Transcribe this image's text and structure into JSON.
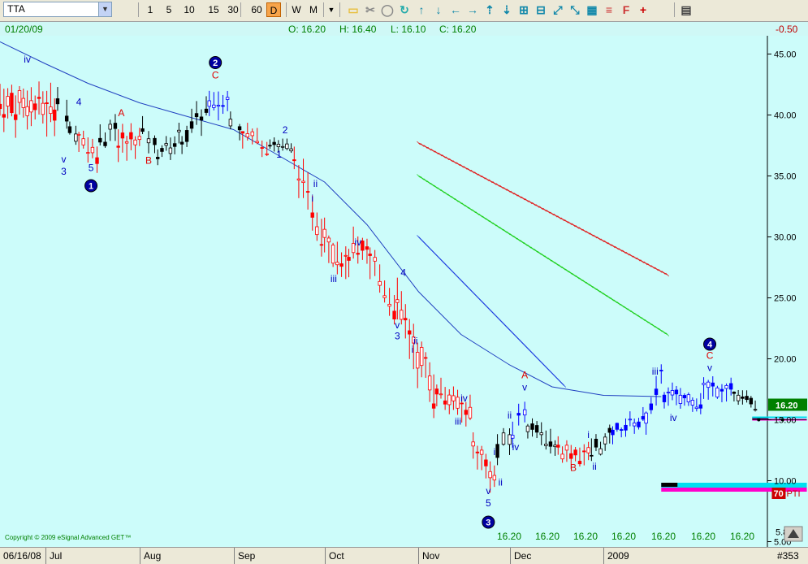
{
  "toolbar": {
    "symbol": "TTA",
    "intervals": [
      "1",
      "5",
      "10",
      "15",
      "30",
      "60",
      "D",
      "W",
      "M"
    ],
    "active_interval": "D"
  },
  "status": {
    "date": "01/20/09",
    "open": "O: 16.20",
    "high": "H: 16.40",
    "low": "L: 16.10",
    "close": "C: 16.20",
    "change": "-0.50"
  },
  "copyright": "Copyright © 2009 eSignal Advanced GET™",
  "footer_values": [
    "16.20",
    "16.20",
    "16.20",
    "16.20",
    "16.20",
    "16.20",
    "16.20"
  ],
  "bottom": {
    "start_date": "06/16/08",
    "months": [
      "Jul",
      "Aug",
      "Sep",
      "Oct",
      "Nov",
      "Dec",
      "2009"
    ],
    "chart_id": "#353"
  },
  "colors": {
    "background": "#ccfcfa",
    "up_red": "#ff0000",
    "blue_bars": "#0000ff",
    "black_bars": "#000000",
    "ma_line": "#2040c0",
    "channel_red": "#e02020",
    "channel_green": "#20d020",
    "channel_blue": "#2040e0",
    "cyan_band": "#00e0f0",
    "magenta_band": "#ff00cc"
  },
  "chart_data": {
    "type": "bar",
    "ylim": [
      4.5,
      46.5
    ],
    "y_ticks": [
      45,
      40,
      35,
      30,
      25,
      20,
      15,
      10,
      5
    ],
    "y_tick_labels": [
      "45.00",
      "40.00",
      "35.00",
      "30.00",
      "25.00",
      "20.00",
      "15.00",
      "10.00",
      "5.00"
    ],
    "current_price_label": "16.20",
    "current_price": 16.2,
    "low_marker_label": "5.80",
    "low_marker": 5.8,
    "pti_value": "70",
    "pti_label": "PTI",
    "x_months": [
      {
        "label": "Jul",
        "date": "2008-07-01"
      },
      {
        "label": "Aug",
        "date": "2008-08-01"
      },
      {
        "label": "Sep",
        "date": "2008-09-01"
      },
      {
        "label": "Oct",
        "date": "2008-10-01"
      },
      {
        "label": "Nov",
        "date": "2008-11-01"
      },
      {
        "label": "Dec",
        "date": "2008-12-01"
      },
      {
        "label": "2009",
        "date": "2009-01-01"
      }
    ],
    "start_date": "2008-06-16",
    "end_date": "2009-02-24",
    "moving_average": [
      [
        "2008-06-16",
        46.0
      ],
      [
        "2008-07-01",
        44.2
      ],
      [
        "2008-07-15",
        42.6
      ],
      [
        "2008-08-01",
        41.0
      ],
      [
        "2008-08-15",
        40.0
      ],
      [
        "2008-09-01",
        38.8
      ],
      [
        "2008-09-15",
        36.8
      ],
      [
        "2008-10-01",
        34.5
      ],
      [
        "2008-10-15",
        31.0
      ],
      [
        "2008-11-01",
        25.5
      ],
      [
        "2008-11-15",
        22.0
      ],
      [
        "2008-12-01",
        19.5
      ],
      [
        "2008-12-15",
        17.7
      ],
      [
        "2009-01-01",
        17.0
      ],
      [
        "2009-01-20",
        16.9
      ]
    ],
    "channels": [
      {
        "color_key": "channel_red",
        "start": [
          "2008-11-01",
          37.7
        ],
        "end": [
          "2009-01-22",
          26.9
        ]
      },
      {
        "color_key": "channel_green",
        "start": [
          "2008-11-01",
          35.0
        ],
        "end": [
          "2009-01-22",
          22.0
        ]
      },
      {
        "color_key": "channel_blue",
        "start": [
          "2008-11-01",
          30.0
        ],
        "end": [
          "2008-12-19",
          17.8
        ]
      }
    ],
    "bar_segments": [
      {
        "color": "red",
        "from": "2008-06-16",
        "to": "2008-07-04",
        "start": 41.0,
        "end": 40.5,
        "range": 3.0
      },
      {
        "color": "black",
        "from": "2008-07-05",
        "to": "2008-07-08",
        "start": 42.0,
        "end": 40.0,
        "range": 2.0
      },
      {
        "color": "black",
        "from": "2008-07-09",
        "to": "2008-07-11",
        "start": 38.5,
        "end": 38.0,
        "range": 1.5
      },
      {
        "color": "red",
        "from": "2008-07-12",
        "to": "2008-07-18",
        "start": 38.5,
        "end": 36.8,
        "range": 2.0
      },
      {
        "color": "black",
        "from": "2008-07-19",
        "to": "2008-07-24",
        "start": 38.0,
        "end": 39.3,
        "range": 1.8
      },
      {
        "color": "red",
        "from": "2008-07-25",
        "to": "2008-08-01",
        "start": 37.5,
        "end": 38.0,
        "range": 2.0
      },
      {
        "color": "black",
        "from": "2008-08-02",
        "to": "2008-08-06",
        "start": 38.5,
        "end": 37.3,
        "range": 1.8
      },
      {
        "color": "black",
        "from": "2008-08-07",
        "to": "2008-08-14",
        "start": 37.0,
        "end": 38.0,
        "range": 1.5
      },
      {
        "color": "black",
        "from": "2008-08-15",
        "to": "2008-08-23",
        "start": 38.0,
        "end": 40.5,
        "range": 2.0
      },
      {
        "color": "blue",
        "from": "2008-08-24",
        "to": "2008-08-30",
        "start": 40.5,
        "end": 41.2,
        "range": 1.8
      },
      {
        "color": "black",
        "from": "2008-08-31",
        "to": "2008-09-03",
        "start": 40.0,
        "end": 39.0,
        "range": 1.5
      },
      {
        "color": "red",
        "from": "2008-09-04",
        "to": "2008-09-12",
        "start": 38.5,
        "end": 37.5,
        "range": 1.5
      },
      {
        "color": "black",
        "from": "2008-09-13",
        "to": "2008-09-20",
        "start": 37.8,
        "end": 37.2,
        "range": 1.0
      },
      {
        "color": "red",
        "from": "2008-09-21",
        "to": "2008-09-30",
        "start": 36.0,
        "end": 30.5,
        "range": 2.5
      },
      {
        "color": "red",
        "from": "2008-10-01",
        "to": "2008-10-08",
        "start": 30.5,
        "end": 27.5,
        "range": 2.5
      },
      {
        "color": "red",
        "from": "2008-10-09",
        "to": "2008-10-15",
        "start": 28.5,
        "end": 28.5,
        "range": 2.5
      },
      {
        "color": "red",
        "from": "2008-10-16",
        "to": "2008-10-24",
        "start": 28.0,
        "end": 24.5,
        "range": 2.5
      },
      {
        "color": "red",
        "from": "2008-10-25",
        "to": "2008-11-06",
        "start": 24.0,
        "end": 17.5,
        "range": 3.0
      },
      {
        "color": "red",
        "from": "2008-11-07",
        "to": "2008-11-18",
        "start": 17.5,
        "end": 15.5,
        "range": 2.0
      },
      {
        "color": "red",
        "from": "2008-11-19",
        "to": "2008-11-26",
        "start": 13.0,
        "end": 10.3,
        "range": 2.0
      },
      {
        "color": "black",
        "from": "2008-11-27",
        "to": "2008-12-01",
        "start": 12.5,
        "end": 13.5,
        "range": 2.0
      },
      {
        "color": "blue",
        "from": "2008-12-02",
        "to": "2008-12-06",
        "start": 14.0,
        "end": 16.0,
        "range": 2.0
      },
      {
        "color": "black",
        "from": "2008-12-07",
        "to": "2008-12-16",
        "start": 14.5,
        "end": 13.0,
        "range": 1.5
      },
      {
        "color": "red",
        "from": "2008-12-17",
        "to": "2008-12-27",
        "start": 12.5,
        "end": 12.0,
        "range": 1.5
      },
      {
        "color": "black",
        "from": "2008-12-28",
        "to": "2009-01-03",
        "start": 12.5,
        "end": 13.5,
        "range": 1.5
      },
      {
        "color": "blue",
        "from": "2009-01-04",
        "to": "2009-01-14",
        "start": 14.0,
        "end": 15.0,
        "range": 1.2
      },
      {
        "color": "blue",
        "from": "2009-01-15",
        "to": "2009-01-20",
        "start": 15.5,
        "end": 18.0,
        "range": 2.0
      },
      {
        "color": "blue",
        "from": "2009-01-21",
        "to": "2009-02-02",
        "start": 17.0,
        "end": 16.5,
        "range": 1.5
      },
      {
        "color": "blue",
        "from": "2009-02-03",
        "to": "2009-02-12",
        "start": 17.5,
        "end": 17.8,
        "range": 1.5
      },
      {
        "color": "black",
        "from": "2009-02-13",
        "to": "2009-02-20",
        "start": 17.0,
        "end": 16.3,
        "range": 1.0
      }
    ],
    "wave_labels": [
      {
        "text": "iv",
        "date": "2008-06-25",
        "y": 44.3,
        "color": "blue"
      },
      {
        "text": "4",
        "date": "2008-07-12",
        "y": 40.8,
        "color": "blue"
      },
      {
        "text": "v",
        "date": "2008-07-07",
        "y": 36.1,
        "color": "blue"
      },
      {
        "text": "3",
        "date": "2008-07-07",
        "y": 35.1,
        "color": "blue"
      },
      {
        "text": "5",
        "date": "2008-07-16",
        "y": 35.4,
        "color": "blue"
      },
      {
        "text": "A",
        "date": "2008-07-26",
        "y": 39.9,
        "color": "red"
      },
      {
        "text": "B",
        "date": "2008-08-04",
        "y": 36.0,
        "color": "red"
      },
      {
        "text": "C",
        "date": "2008-08-26",
        "y": 43.0,
        "color": "red"
      },
      {
        "text": "1",
        "date": "2008-09-16",
        "y": 36.5,
        "color": "blue"
      },
      {
        "text": "2",
        "date": "2008-09-18",
        "y": 38.5,
        "color": "blue"
      },
      {
        "text": "ii",
        "date": "2008-09-28",
        "y": 34.1,
        "color": "blue"
      },
      {
        "text": "i",
        "date": "2008-09-27",
        "y": 32.9,
        "color": "blue"
      },
      {
        "text": "iv",
        "date": "2008-10-12",
        "y": 29.3,
        "color": "blue"
      },
      {
        "text": "iii",
        "date": "2008-10-04",
        "y": 26.3,
        "color": "blue"
      },
      {
        "text": "4",
        "date": "2008-10-27",
        "y": 26.8,
        "color": "blue"
      },
      {
        "text": "v",
        "date": "2008-10-25",
        "y": 22.5,
        "color": "blue"
      },
      {
        "text": "3",
        "date": "2008-10-25",
        "y": 21.6,
        "color": "blue"
      },
      {
        "text": "ii",
        "date": "2008-10-31",
        "y": 21.2,
        "color": "blue"
      },
      {
        "text": "i",
        "date": "2008-10-30",
        "y": 20.5,
        "color": "blue"
      },
      {
        "text": "iv",
        "date": "2008-11-16",
        "y": 16.5,
        "color": "blue"
      },
      {
        "text": "iii",
        "date": "2008-11-14",
        "y": 14.6,
        "color": "blue"
      },
      {
        "text": "i",
        "date": "2008-11-26",
        "y": 12.1,
        "color": "blue"
      },
      {
        "text": "v",
        "date": "2008-11-24",
        "y": 8.9,
        "color": "blue"
      },
      {
        "text": "5",
        "date": "2008-11-24",
        "y": 7.9,
        "color": "blue"
      },
      {
        "text": "ii",
        "date": "2008-11-28",
        "y": 9.6,
        "color": "blue"
      },
      {
        "text": "ii",
        "date": "2008-12-01",
        "y": 15.1,
        "color": "blue"
      },
      {
        "text": "iv",
        "date": "2008-12-03",
        "y": 12.5,
        "color": "blue"
      },
      {
        "text": "A",
        "date": "2008-12-06",
        "y": 18.4,
        "color": "red"
      },
      {
        "text": "v",
        "date": "2008-12-06",
        "y": 17.4,
        "color": "blue"
      },
      {
        "text": "B",
        "date": "2008-12-22",
        "y": 10.8,
        "color": "red"
      },
      {
        "text": "i",
        "date": "2008-12-27",
        "y": 13.5,
        "color": "blue"
      },
      {
        "text": "ii",
        "date": "2008-12-29",
        "y": 10.9,
        "color": "blue"
      },
      {
        "text": "iii",
        "date": "2009-01-18",
        "y": 18.7,
        "color": "blue"
      },
      {
        "text": "iv",
        "date": "2009-01-24",
        "y": 14.9,
        "color": "blue"
      },
      {
        "text": "C",
        "date": "2009-02-05",
        "y": 20.0,
        "color": "red"
      },
      {
        "text": "v",
        "date": "2009-02-05",
        "y": 19.0,
        "color": "blue"
      }
    ],
    "wave_circles": [
      {
        "text": "1",
        "date": "2008-07-16",
        "y": 34.2
      },
      {
        "text": "2",
        "date": "2008-08-26",
        "y": 44.3
      },
      {
        "text": "3",
        "date": "2008-11-24",
        "y": 6.6
      },
      {
        "text": "4",
        "date": "2009-02-05",
        "y": 21.2
      }
    ],
    "target_zone": {
      "upper": {
        "date_from": "2009-02-19",
        "date_to": "2009-03-09",
        "price": 15.0
      },
      "lower": {
        "date_from": "2009-01-20",
        "date_to": "2009-03-09",
        "price": 9.5
      }
    }
  }
}
